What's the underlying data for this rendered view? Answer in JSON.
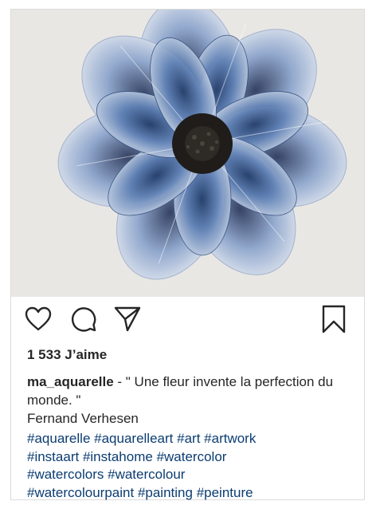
{
  "post": {
    "image_alt": "Blue watercolor anemone flower",
    "likes": "1 533 J’aime",
    "username": "ma_aquarelle",
    "caption_text": " - \" Une fleur invente la perfection du monde. \"",
    "caption_author": "Fernand Verhesen",
    "hashtags": [
      "#aquarelle",
      "#aquarelleart",
      "#art",
      "#artwork",
      "#instaart",
      "#instahome",
      "#watercolor",
      "#watercolors",
      "#watercolour",
      "#watercolourpaint",
      "#painting",
      "#peinture"
    ]
  },
  "actions": {
    "like_icon": "heart-icon",
    "comment_icon": "comment-icon",
    "share_icon": "paper-plane-icon",
    "save_icon": "bookmark-icon"
  },
  "colors": {
    "hashtag": "#0b3d72",
    "text": "#262626",
    "image_bg": "#e9e7e4",
    "petal_blue": "#4f6fa3",
    "center": "#1f1c1a"
  }
}
